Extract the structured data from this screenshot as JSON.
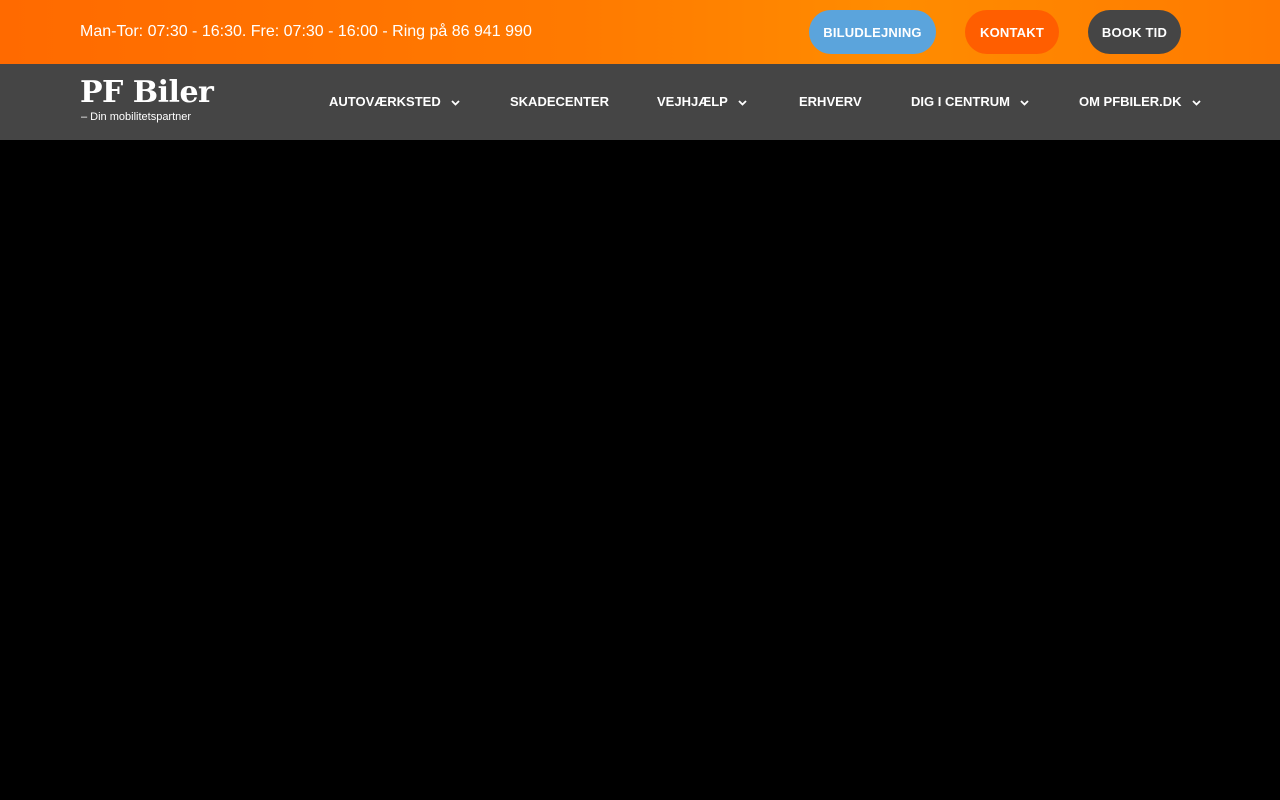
{
  "topbar": {
    "hours_text": "Man-Tor: 07:30 - 16:30. Fre: 07:30 - 16:00 - Ring på 86 941 990",
    "buttons": {
      "rental": "BILUDLEJNING",
      "contact": "KONTAKT",
      "book": "BOOK TID"
    },
    "colors": {
      "gradient_start": "#ff6a00",
      "gradient_end": "#ff8c00",
      "rental_bg": "#5ba4dc",
      "contact_bg": "#ff5e00",
      "book_bg": "#454545"
    }
  },
  "navbar": {
    "logo": {
      "name": "PF Biler",
      "tagline": "– Din mobilitetspartner"
    },
    "items": [
      {
        "label": "AUTOVÆRKSTED",
        "has_dropdown": true,
        "icon": "chevron-down-icon"
      },
      {
        "label": "SKADECENTER",
        "has_dropdown": false
      },
      {
        "label": "VEJHJÆLP",
        "has_dropdown": true,
        "icon": "chevron-down-icon"
      },
      {
        "label": "ERHVERV",
        "has_dropdown": false
      },
      {
        "label": "DIG I CENTRUM",
        "has_dropdown": true,
        "icon": "chevron-down-icon"
      },
      {
        "label": "OM PFBILER.DK",
        "has_dropdown": true,
        "icon": "chevron-down-icon"
      }
    ],
    "background": "#454545"
  },
  "content": {
    "background": "#000000"
  }
}
